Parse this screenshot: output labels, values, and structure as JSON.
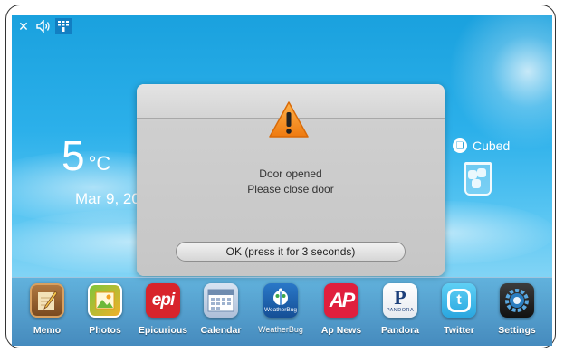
{
  "status_bar": {
    "icons": [
      "close-icon",
      "speaker-icon",
      "keypad-icon"
    ]
  },
  "weather": {
    "temperature": "5",
    "unit": "°C",
    "date": "Mar 9, 20"
  },
  "ice_widget": {
    "label": "Cubed",
    "icon": "ice-cup-icon"
  },
  "dialog": {
    "icon": "warning-icon",
    "line1": "Door opened",
    "line2": "Please close door",
    "button": "OK (press it for 3 seconds)"
  },
  "dock": {
    "apps": [
      {
        "label": "Memo",
        "icon": "memo-icon"
      },
      {
        "label": "Photos",
        "icon": "photos-icon"
      },
      {
        "label": "Epicurious",
        "icon": "epicurious-icon",
        "glyph": "epi"
      },
      {
        "label": "Calendar",
        "icon": "calendar-icon"
      },
      {
        "label": "WeatherBug",
        "icon": "weatherbug-icon",
        "glyph": "WeatherBug"
      },
      {
        "label": "Ap News",
        "icon": "ap-news-icon",
        "glyph": "AP"
      },
      {
        "label": "Pandora",
        "icon": "pandora-icon",
        "glyph": "P",
        "glyph2": "PANDORA"
      },
      {
        "label": "Twitter",
        "icon": "twitter-icon",
        "glyph": "t"
      },
      {
        "label": "Settings",
        "icon": "settings-icon"
      }
    ]
  },
  "colors": {
    "sky": "#2cb0ea",
    "warning": "#f08a1c",
    "epicurious": "#d8242b",
    "ap": "#e01f3d",
    "twitter": "#3ab6e8"
  }
}
